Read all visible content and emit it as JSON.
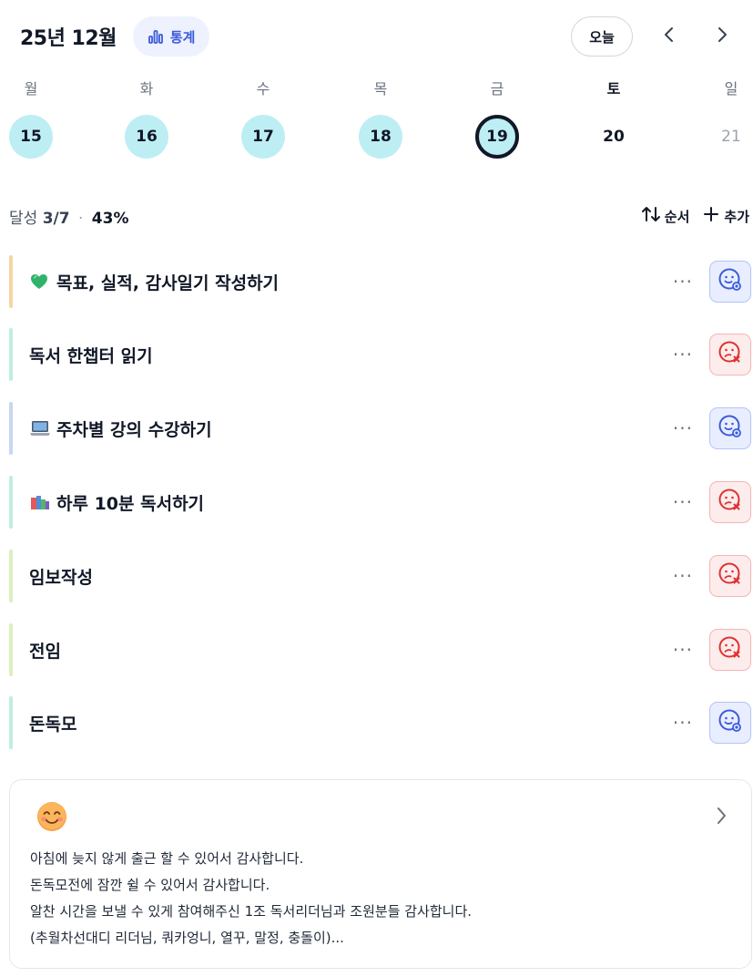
{
  "header": {
    "month_title": "25년 12월",
    "stats_label": "통계",
    "today_label": "오늘",
    "accent": "#3b5bdb"
  },
  "week": {
    "days": [
      {
        "name": "월",
        "num": "15",
        "state": "done"
      },
      {
        "name": "화",
        "num": "16",
        "state": "done"
      },
      {
        "name": "수",
        "num": "17",
        "state": "done"
      },
      {
        "name": "목",
        "num": "18",
        "state": "done"
      },
      {
        "name": "금",
        "num": "19",
        "state": "selected"
      },
      {
        "name": "토",
        "num": "20",
        "state": "future"
      },
      {
        "name": "일",
        "num": "21",
        "state": "future-dim"
      }
    ],
    "done_color": "#bdeef4"
  },
  "summary": {
    "label": "달성",
    "fraction": "3/7",
    "separator": "·",
    "percent": "43%",
    "sort_label": "순서",
    "add_label": "추가"
  },
  "tasks": [
    {
      "label": "목표, 실적, 감사일기 작성하기",
      "icon": "green-heart-icon",
      "bar_color": "#f5d6a3",
      "status": "success"
    },
    {
      "label": "독서 한챕터 읽기",
      "icon": "",
      "bar_color": "#bfeee0",
      "status": "fail"
    },
    {
      "label": "주차별 강의 수강하기",
      "icon": "laptop-icon",
      "bar_color": "#c9d6f3",
      "status": "success"
    },
    {
      "label": "하루 10분 독서하기",
      "icon": "books-icon",
      "bar_color": "#bfeee0",
      "status": "fail"
    },
    {
      "label": "임보작성",
      "icon": "",
      "bar_color": "#dcefc0",
      "status": "fail"
    },
    {
      "label": "전임",
      "icon": "",
      "bar_color": "#dcefc0",
      "status": "fail"
    },
    {
      "label": "돈독모",
      "icon": "",
      "bar_color": "#bfeee0",
      "status": "success"
    }
  ],
  "task_more_label": "···",
  "gratitude": {
    "icon": "smiling-face-icon",
    "lines": [
      "아침에 늦지 않게 출근 할 수 있어서 감사합니다.",
      "돈독모전에 잠깐 쉴 수 있어서 감사합니다.",
      "알찬 시간을 보낼 수 있게 참여해주신 1조 독서리더님과 조원분들 감사합니다.",
      "(추월차선대디 리더님, 쿼카엉니, 열꾸, 말정, 충돌이)..."
    ]
  }
}
